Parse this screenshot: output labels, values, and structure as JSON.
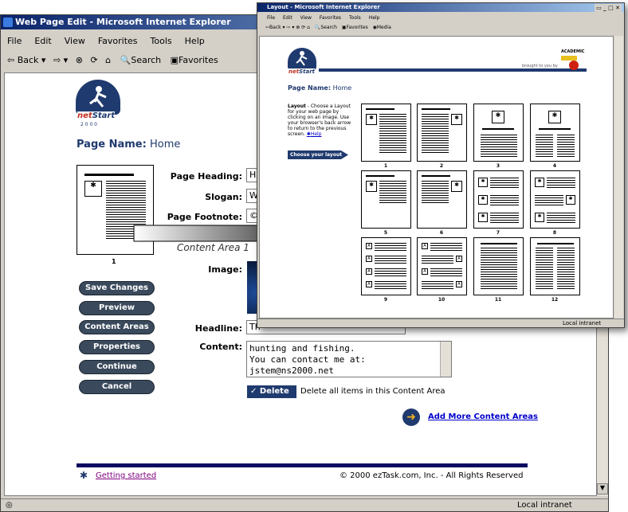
{
  "back_window": {
    "title": "Web Page Edit - Microsoft Internet Explorer",
    "menu": [
      "File",
      "Edit",
      "View",
      "Favorites",
      "Tools",
      "Help"
    ],
    "toolbar": {
      "back": "Back",
      "search": "Search",
      "favorites": "Favorites"
    },
    "page_name_label": "Page Name:",
    "page_name": "Home",
    "layout_number": "1",
    "fields": {
      "page_heading_label": "Page Heading:",
      "page_heading_value": "H",
      "slogan_label": "Slogan:",
      "slogan_value": "W",
      "footnote_label": "Page Footnote:",
      "footnote_value": "©2",
      "content_area_label": "Content Area 1",
      "image_label": "Image:",
      "headline_label": "Headline:",
      "headline_value": "Th",
      "content_label": "Content:"
    },
    "content_lines": [
      "hunting and fishing.",
      "You can contact me at:",
      "jstem@ns2000.net"
    ],
    "buttons": [
      "Save Changes",
      "Preview",
      "Content Areas",
      "Properties",
      "Continue",
      "Cancel"
    ],
    "delete_button": "Delete",
    "delete_text": "Delete all items in this Content Area",
    "add_more": "Add More Content Areas",
    "getting_started": "Getting started",
    "copyright": "© 2000 ezTask.com, Inc. - All Rights Reserved",
    "status_zone": "Local intranet"
  },
  "front_window": {
    "title": "Layout - Microsoft Internet Explorer",
    "menu": [
      "File",
      "Edit",
      "View",
      "Favorites",
      "Tools",
      "Help"
    ],
    "toolbar": {
      "back": "Back",
      "search": "Search",
      "favorites": "Favorites",
      "media": "Media"
    },
    "brought_by": "brought to you by",
    "academic": "ACADEMIC",
    "page_name_label": "Page Name:",
    "page_name": "Home",
    "instructions_title": "Layout",
    "instructions": " - Choose a Layout for your web page by clicking on an image. Use your browser's back arrow to return to the previous screen.",
    "help": "Help",
    "choose_label": "Choose your layout",
    "layout_numbers": [
      "1",
      "2",
      "3",
      "4",
      "5",
      "6",
      "7",
      "8",
      "9",
      "10",
      "11",
      "12"
    ],
    "status_zone": "Local intranet"
  },
  "logo": {
    "line1": "net",
    "line2": "Start",
    "line3": "2 0 0 0"
  }
}
